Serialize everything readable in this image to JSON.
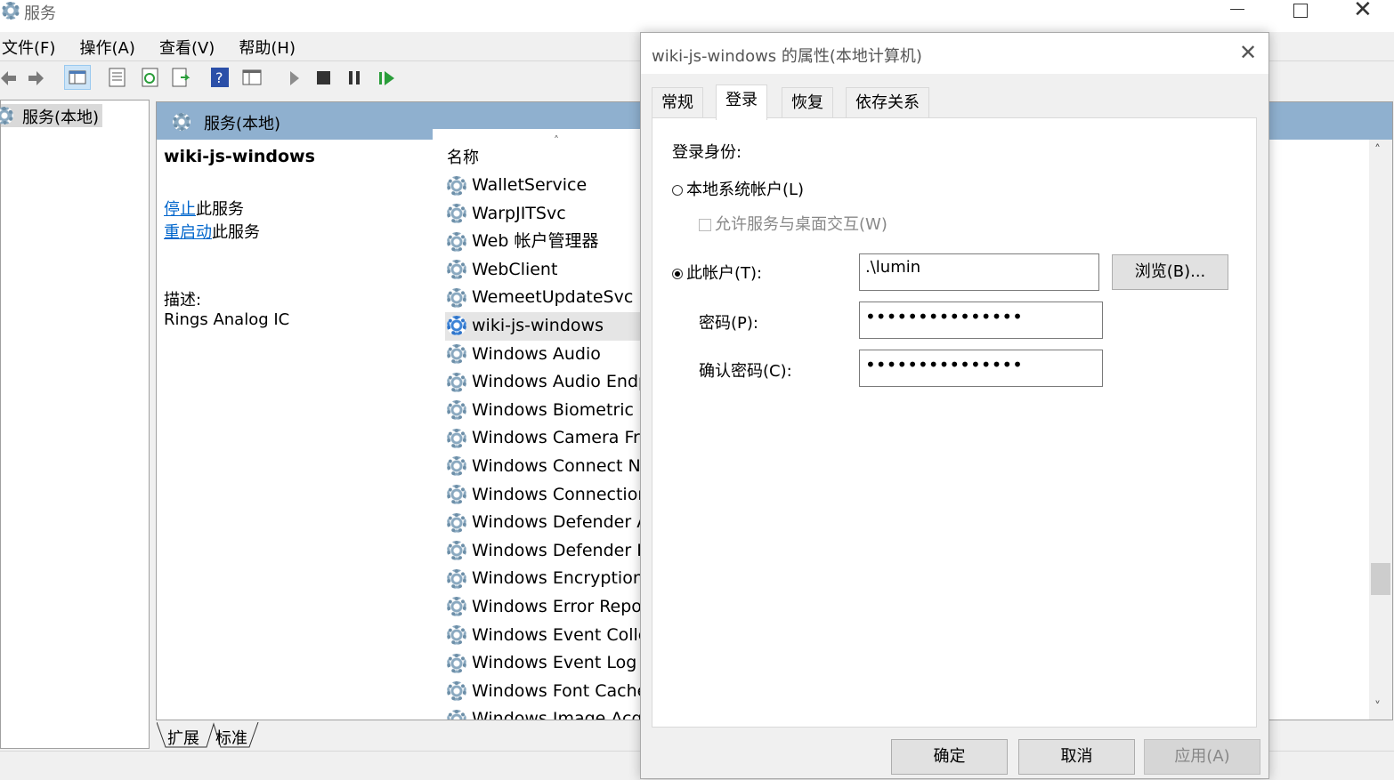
{
  "window": {
    "title": "服务"
  },
  "menu": [
    "文件(F)",
    "操作(A)",
    "查看(V)",
    "帮助(H)"
  ],
  "tree": {
    "root": "服务(本地)"
  },
  "pane": {
    "header": "服务(本地)",
    "service_name": "wiki-js-windows",
    "stop_link": "停止",
    "stop_suffix": "此服务",
    "restart_link": "重启动",
    "restart_suffix": "此服务",
    "desc_label": "描述:",
    "desc_value": "Rings Analog IC"
  },
  "list": {
    "col_name": "名称",
    "rows": [
      "WalletService",
      "WarpJITSvc",
      "Web 帐户管理器",
      "WebClient",
      "WemeetUpdateSvc",
      "wiki-js-windows",
      "Windows Audio",
      "Windows Audio Endpoir",
      "Windows Biometric Serv",
      "Windows Camera Frame",
      "Windows Connect Now",
      "Windows Connection M",
      "Windows Defender Adv",
      "Windows Defender Fire",
      "Windows Encryption Pro",
      "Windows Error Reportin",
      "Windows Event Collecto",
      "Windows Event Log",
      "Windows Font Cache Se",
      "Windows Image Acquisi"
    ],
    "selected_index": 5
  },
  "bottom_tabs": [
    "扩展",
    "标准"
  ],
  "dialog": {
    "title": "wiki-js-windows 的属性(本地计算机)",
    "tabs": [
      "常规",
      "登录",
      "恢复",
      "依存关系"
    ],
    "active_tab": "登录",
    "logon_label": "登录身份:",
    "local_system": "本地系统帐户(L)",
    "allow_desktop": "允许服务与桌面交互(W)",
    "this_account": "此帐户(T):",
    "account_value": ".\\lumin",
    "browse": "浏览(B)...",
    "password_label": "密码(P):",
    "password_value": "•••••••••••••••",
    "confirm_label": "确认密码(C):",
    "confirm_value": "•••••••••••••••",
    "ok": "确定",
    "cancel": "取消",
    "apply": "应用(A)"
  }
}
